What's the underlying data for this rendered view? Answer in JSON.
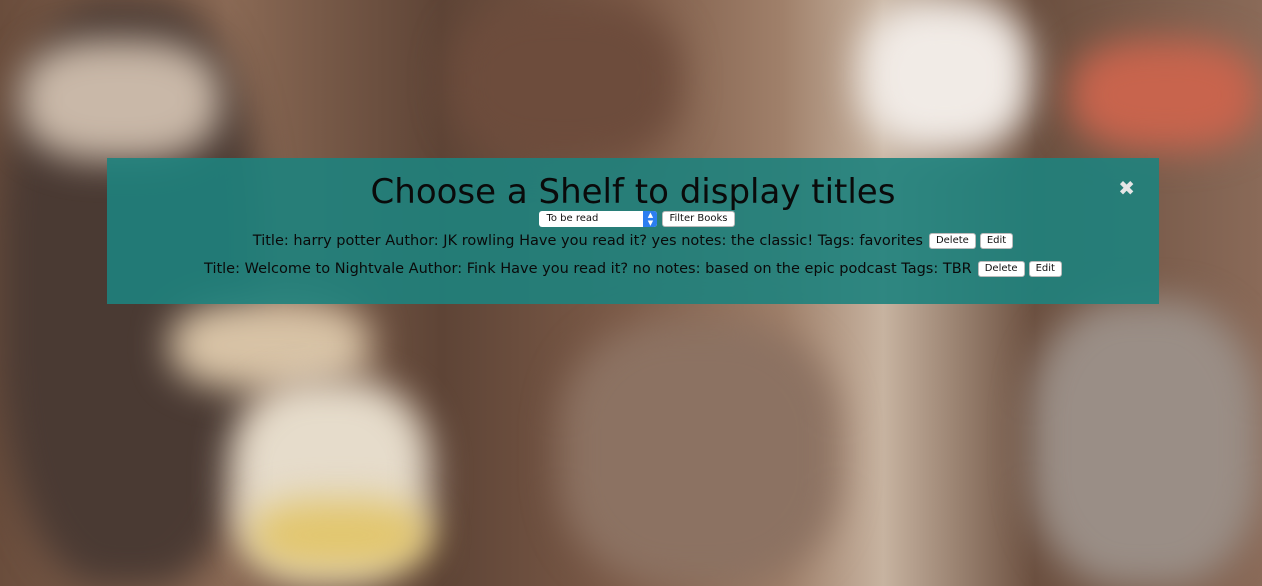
{
  "header": {
    "title": "Choose a Shelf to display titles",
    "close_glyph": "✖"
  },
  "filter": {
    "selected_shelf": "To be read",
    "button_label": "Filter Books"
  },
  "books": [
    {
      "text": "Title: harry potter Author: JK rowling Have you read it? yes notes: the classic! Tags: favorites",
      "delete_label": "Delete",
      "edit_label": "Edit"
    },
    {
      "text": "Title: Welcome to Nightvale Author: Fink Have you read it? no notes: based on the epic podcast Tags: TBR",
      "delete_label": "Delete",
      "edit_label": "Edit"
    }
  ],
  "colors": {
    "overlay": "#1e827d",
    "select_arrow": "#2c7ef0"
  },
  "icons": {
    "close": "close-icon",
    "select_arrows": "chevron-up-down-icon"
  }
}
